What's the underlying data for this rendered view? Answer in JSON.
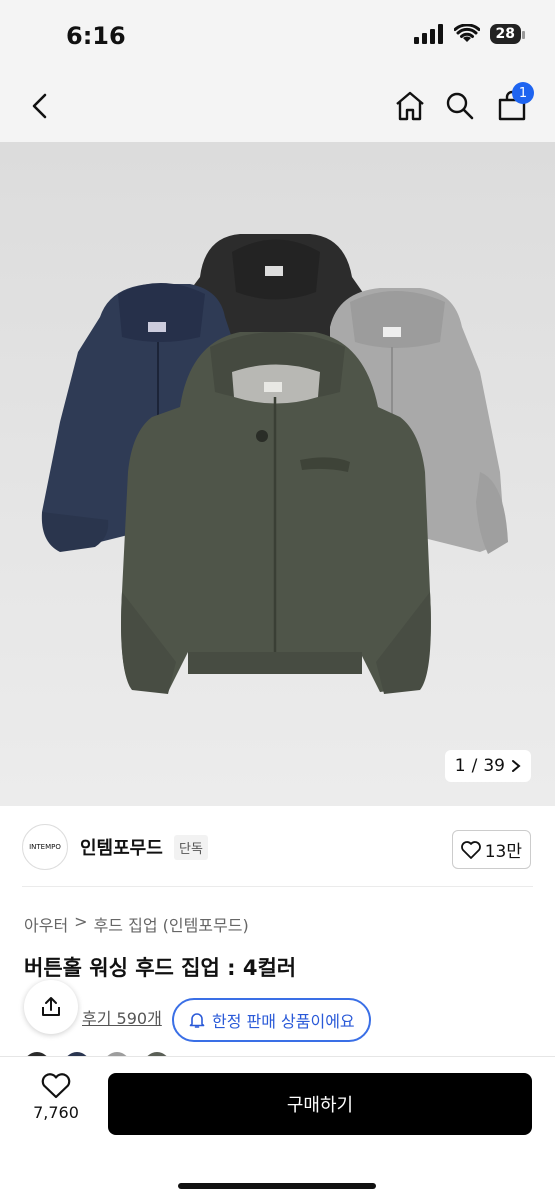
{
  "status": {
    "time": "6:16",
    "battery": "28"
  },
  "header": {
    "cart_count": "1"
  },
  "gallery": {
    "current": "1",
    "separator": "/",
    "total": "39"
  },
  "brand": {
    "logo_text": "INTEMPO",
    "name": "인템포무드",
    "tag": "단독",
    "likes": "13만"
  },
  "breadcrumb": {
    "first": "아우터",
    "separator": ">",
    "second": "후드 집업 (인템포무드)"
  },
  "product": {
    "title": "버튼홀 워싱 후드 집업 : 4컬러",
    "reviews": "후기 590개",
    "limited_notice": "한정 판매 상품이에요",
    "swatch_colors": [
      "#2b2b2b",
      "#2a3550",
      "#9d9d9d",
      "#5a5f56"
    ]
  },
  "bottom": {
    "wish_count": "7,760",
    "buy_label": "구매하기"
  },
  "colors": {
    "accent": "#1e64f0",
    "hoodie_green": "#4f5549",
    "hoodie_navy": "#2f3b55",
    "hoodie_black": "#2c2c2c",
    "hoodie_grey": "#a9a9a9"
  }
}
